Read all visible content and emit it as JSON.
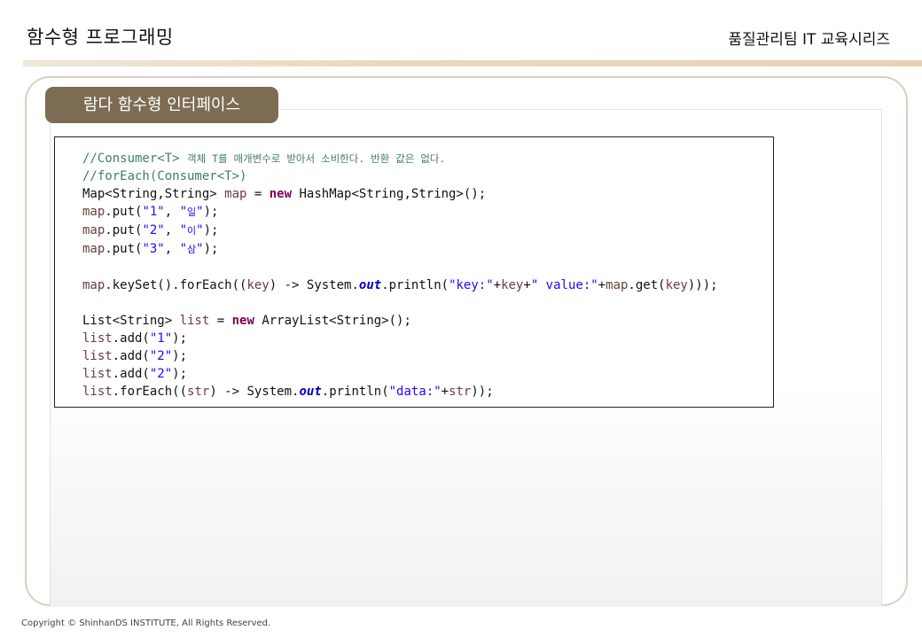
{
  "header": {
    "title": "함수형 프로그래밍",
    "series": "품질관리팀 IT 교육시리즈"
  },
  "section": {
    "tab_label": "람다 함수형 인터페이스"
  },
  "code": {
    "c1a": "//Consumer<T> ",
    "c1b": "객체 T를 매개변수로 받아서 소비한다. 반환 값은 없다.",
    "c2": "//forEach(Consumer<T>)",
    "l3a": "Map<String,String> ",
    "l3b": "map",
    "l3c": " = ",
    "l3d": "new",
    "l3e": " HashMap<String,String>();",
    "put1a": "map",
    "put1b": ".put(",
    "put1c": "\"1\"",
    "put1d": ", ",
    "put1e": "\"",
    "put1f": "일",
    "put1g": "\"",
    "put1h": ");",
    "put2a": "map",
    "put2b": ".put(",
    "put2c": "\"2\"",
    "put2d": ", ",
    "put2e": "\"",
    "put2f": "이",
    "put2g": "\"",
    "put2h": ");",
    "put3a": "map",
    "put3b": ".put(",
    "put3c": "\"3\"",
    "put3d": ", ",
    "put3e": "\"",
    "put3f": "삼",
    "put3g": "\"",
    "put3h": ");",
    "fe1a": "map",
    "fe1b": ".keySet().forEach((",
    "fe1c": "key",
    "fe1d": ") -> System.",
    "fe1e": "out",
    "fe1f": ".println(",
    "fe1g": "\"key:\"",
    "fe1h": "+",
    "fe1i": "key",
    "fe1j": "+",
    "fe1k": "\" value:\"",
    "fe1l": "+",
    "fe1m": "map",
    "fe1n": ".get(",
    "fe1o": "key",
    "fe1p": ")));",
    "ls1a": "List<String> ",
    "ls1b": "list",
    "ls1c": " = ",
    "ls1d": "new",
    "ls1e": " ArrayList<String>();",
    "add1a": "list",
    "add1b": ".add(",
    "add1c": "\"1\"",
    "add1d": ");",
    "add2a": "list",
    "add2b": ".add(",
    "add2c": "\"2\"",
    "add2d": ");",
    "add3a": "list",
    "add3b": ".add(",
    "add3c": "\"2\"",
    "add3d": ");",
    "fe2a": "list",
    "fe2b": ".forEach((",
    "fe2c": "str",
    "fe2d": ") -> System.",
    "fe2e": "out",
    "fe2f": ".println(",
    "fe2g": "\"data:\"",
    "fe2h": "+",
    "fe2i": "str",
    "fe2j": "));"
  },
  "footer": {
    "copyright": "Copyright © ShinhanDS INSTITUTE, All Rights Reserved."
  }
}
